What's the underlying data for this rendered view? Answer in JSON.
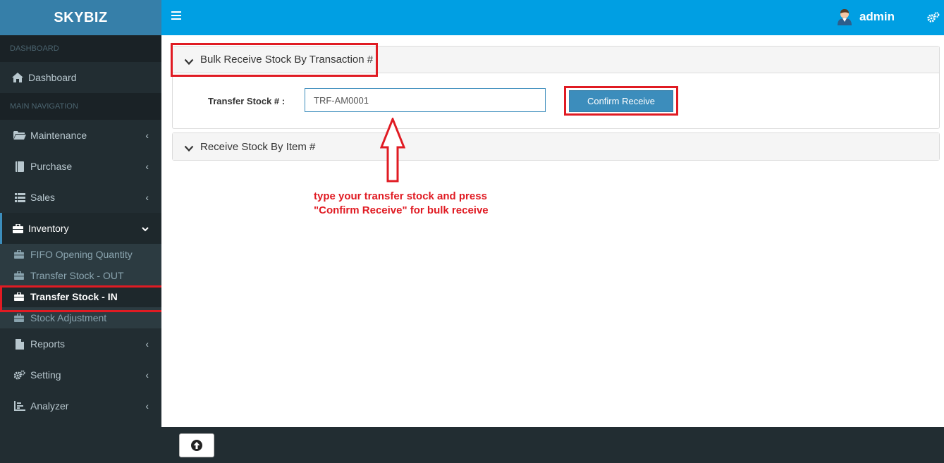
{
  "brand": "SKYBIZ",
  "sidebar": {
    "section_dashboard": "DASHBOARD",
    "dashboard": "Dashboard",
    "section_main": "MAIN NAVIGATION",
    "maintenance": "Maintenance",
    "purchase": "Purchase",
    "sales": "Sales",
    "inventory": "Inventory",
    "inventory_sub": [
      "FIFO Opening Quantity",
      "Transfer Stock - OUT",
      "Transfer Stock - IN",
      "Stock Adjustment"
    ],
    "reports": "Reports",
    "setting": "Setting",
    "analyzer": "Analyzer"
  },
  "header": {
    "user": "admin"
  },
  "panel_bulk": {
    "title": "Bulk Receive Stock By Transaction #",
    "label": "Transfer Stock # :",
    "input_value": "TRF-AM0001",
    "button": "Confirm Receive"
  },
  "panel_item": {
    "title": "Receive Stock By Item #"
  },
  "annotation": {
    "line1": "type your transfer stock and press",
    "line2": "\"Confirm Receive\" for bulk receive"
  },
  "colors": {
    "topbar": "#009fe3",
    "sidebar": "#222d32",
    "highlight": "#e01b23",
    "button": "#3c8dbc"
  }
}
